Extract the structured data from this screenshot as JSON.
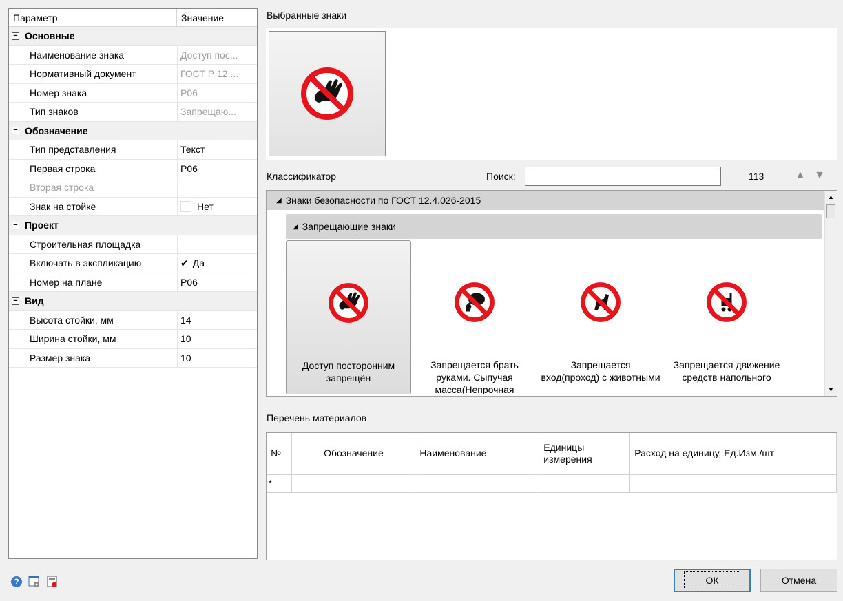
{
  "propgrid": {
    "header": {
      "param": "Параметр",
      "value": "Значение"
    },
    "cats": [
      {
        "title": "Основные",
        "rows": [
          {
            "label": "Наименование знака",
            "value": "Доступ пос...",
            "readonly": true
          },
          {
            "label": "Нормативный документ",
            "value": "ГОСТ Р 12....",
            "readonly": true
          },
          {
            "label": "Номер знака",
            "value": "Р06",
            "readonly": true
          },
          {
            "label": "Тип знаков",
            "value": "Запрещаю...",
            "readonly": true
          }
        ]
      },
      {
        "title": "Обозначение",
        "rows": [
          {
            "label": "Тип представления",
            "value": "Текст"
          },
          {
            "label": "Первая строка",
            "value": "Р06"
          },
          {
            "label": "Вторая строка",
            "value": ""
          },
          {
            "label": "Знак на стойке",
            "value": "Нет"
          }
        ]
      },
      {
        "title": "Проект",
        "rows": [
          {
            "label": "Строительная площадка",
            "value": ""
          },
          {
            "label": "Включать в экспликацию",
            "value": "Да",
            "check": "✔"
          },
          {
            "label": "Номер на плане",
            "value": "Р06"
          }
        ]
      },
      {
        "title": "Вид",
        "rows": [
          {
            "label": "Высота стойки, мм",
            "value": "14"
          },
          {
            "label": "Ширина стойки, мм",
            "value": "10"
          },
          {
            "label": "Размер знака",
            "value": "10"
          }
        ]
      }
    ],
    "collapse_glyph": "−"
  },
  "selected": {
    "title": "Выбранные знаки"
  },
  "classifier": {
    "title": "Классификатор",
    "search_label": "Поиск:",
    "search_value": "",
    "count": "113",
    "group": "Знаки безопасности по ГОСТ 12.4.026-2015",
    "subgroup": "Запрещающие знаки",
    "signs": [
      {
        "label": "Доступ посторонним запрещён",
        "icon": "no-entry-hand-icon"
      },
      {
        "label": "Запрещается брать руками. Сыпучая масса(Непрочная",
        "icon": "no-touch-icon"
      },
      {
        "label": "Запрещается вход(проход) с животными",
        "icon": "no-animals-icon"
      },
      {
        "label": "Запрещается движение средств напольного",
        "icon": "no-forklift-icon"
      }
    ],
    "triangle": "◢"
  },
  "materials": {
    "title": "Перечень материалов",
    "columns": [
      "№",
      "Обозначение",
      "Наименование",
      "Единицы измерения",
      "Расход на единицу, Ед.Изм./шт"
    ],
    "new_row_marker": "*"
  },
  "buttons": {
    "ok": "ОК",
    "cancel": "Отмена"
  },
  "colors": {
    "sign_red": "#e8141c",
    "accent": "#3c7fb1"
  }
}
